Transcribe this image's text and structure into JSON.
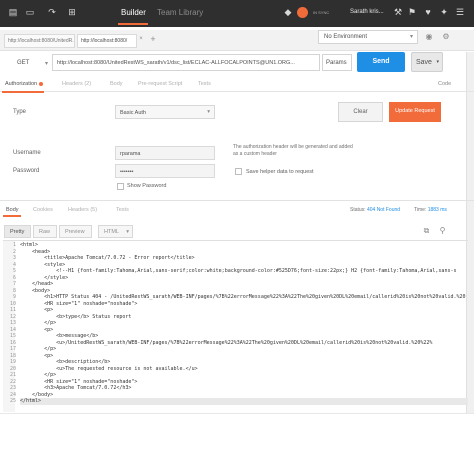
{
  "topbar": {
    "builder_tab": "Builder",
    "team_library_tab": "Team Library",
    "sync_label": "IN SYNC",
    "user_name": "Sarath kris..."
  },
  "url_tabs": [
    {
      "label": "http://localhost:8080/UnitedR..."
    },
    {
      "label": "http://localhost:8080/"
    }
  ],
  "environment": {
    "selected": "No Environment"
  },
  "request": {
    "method": "GET",
    "url": "http://localhost:8080/UnitedRestWS_sarath/v1/dsc_list/ECLAC-ALLFOCALPOINTS@UN1.ORG...",
    "params_label": "Params",
    "send_label": "Send",
    "save_label": "Save"
  },
  "request_tabs": {
    "authorization": "Authorization",
    "headers": "Headers (2)",
    "body": "Body",
    "prerequest": "Pre-request Script",
    "tests": "Tests",
    "code_link": "Code"
  },
  "auth": {
    "type_label": "Type",
    "type_value": "Basic Auth",
    "clear_label": "Clear",
    "update_label": "Update Request",
    "username_label": "Username",
    "username_value": "rparama",
    "password_label": "Password",
    "password_value": "•••••••",
    "show_password_label": "Show Password",
    "info_text": "The authorization header will be generated and added as a custom header",
    "save_helper_label": "Save helper data to request"
  },
  "response": {
    "tabs": {
      "body": "Body",
      "cookies": "Cookies",
      "headers": "Headers (5)",
      "tests": "Tests"
    },
    "status_label": "Status:",
    "status_value": "404 Not Found",
    "time_label": "Time:",
    "time_value": "1883 ms",
    "format_buttons": {
      "pretty": "Pretty",
      "raw": "Raw",
      "preview": "Preview",
      "html": "HTML"
    }
  },
  "code": {
    "line_numbers": [
      "1",
      "2",
      "3",
      "4",
      "5",
      "6",
      "7",
      "8",
      "9",
      "10",
      "11",
      "12",
      "13",
      "14",
      "15",
      "16",
      "17",
      "18",
      "19",
      "20",
      "21",
      "22",
      "23",
      "24",
      "25"
    ],
    "lines": [
      "<html>",
      "    <head>",
      "        <title>Apache Tomcat/7.0.72 - Error report</title>",
      "        <style>",
      "            <!--H1 {font-family:Tahoma,Arial,sans-serif;color:white;background-color:#525D76;font-size:22px;} H2 {font-family:Tahoma,Arial,sans-s",
      "        </style>",
      "    </head>",
      "    <body>",
      "        <h1>HTTP Status 404 - /UnitedRestWS_sarath/WEB-INF/pages/%7B%22errorMessage%22%3A%22The%20given%20DL%20email/callerid%20is%20not%20valid.%20",
      "        <HR size=\"1\" noshade=\"noshade\">",
      "        <p>",
      "            <b>type</b> Status report",
      "        </p>",
      "        <p>",
      "            <b>message</b>",
      "            <u>/UnitedRestWS_sarath/WEB-INF/pages/%7B%22errorMessage%22%3A%22The%20given%20DL%20email/callerid%20is%20not%20valid.%20%22%",
      "        </p>",
      "        <p>",
      "            <b>description</b>",
      "            <u>The requested resource is not available.</u>",
      "        </p>",
      "        <HR size=\"1\" noshade=\"noshade\">",
      "        <h3>Apache Tomcat/7.0.72</h3>",
      "    </body>",
      "</html>"
    ]
  },
  "colors": {
    "accent": "#f26b3a",
    "send_blue": "#1f8ee5",
    "topbar": "#2f2f2f"
  }
}
